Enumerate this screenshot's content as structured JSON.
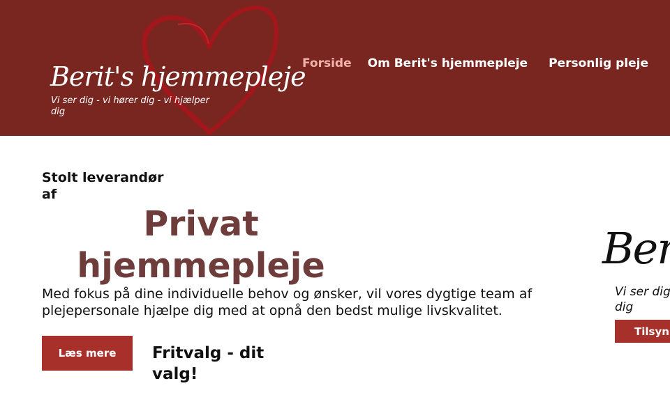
{
  "header": {
    "logo_text": "Berit's hjemmepleje",
    "tagline": "Vi ser dig - vi hører dig - vi hjælper dig"
  },
  "nav": {
    "items": [
      {
        "label": "Forside",
        "active": true
      },
      {
        "label": "Om Berit's hjemmepleje",
        "active": false
      },
      {
        "label": "Personlig pleje",
        "active": false
      }
    ]
  },
  "main": {
    "intro": "Stolt leverandør af",
    "title": "Privat hjemmepleje",
    "description": "Med fokus på dine individuelle behov og ønsker, vil vores dygtige team af plejepersonale hjælpe dig med at opnå den bedst mulige livskvalitet.",
    "read_more_label": "Læs mere",
    "fritvalg": "Fritvalg - dit valg!"
  },
  "side_card": {
    "logo_text": "Berit's",
    "tagline": "Vi ser dig - vi hjælper dig",
    "button_label": "Tilsyn"
  },
  "colors": {
    "header_bg": "#7a2620",
    "accent": "#a8302b",
    "title": "#6e3c3b",
    "nav_active": "#f4b3a8"
  }
}
